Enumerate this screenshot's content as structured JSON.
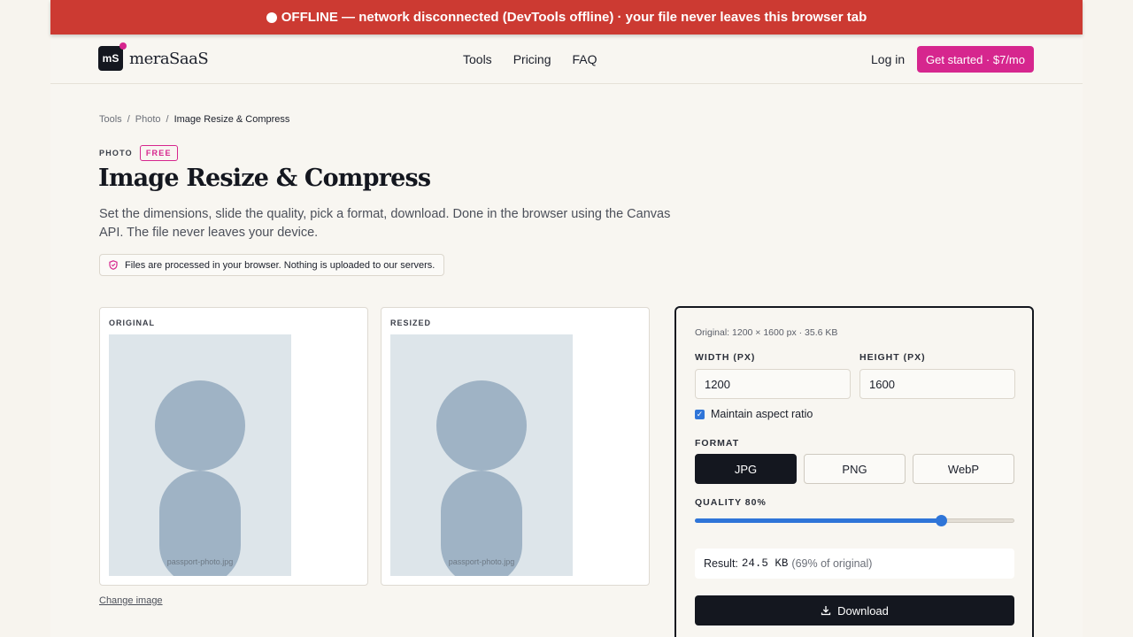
{
  "offline_banner": {
    "icon": "dot-icon",
    "text": "OFFLINE — network disconnected (DevTools offline) · your file never leaves this browser tab",
    "color": "#cc3a32"
  },
  "brand": {
    "mark": "mS",
    "name": "meraSaaS",
    "accent": "#d6268e"
  },
  "nav": {
    "links": [
      "Tools",
      "Pricing",
      "FAQ"
    ],
    "login": "Log in",
    "cta": "Get started · $7/mo"
  },
  "breadcrumb": {
    "items": [
      "Tools",
      "Photo"
    ],
    "current": "Image Resize & Compress",
    "separator": "/"
  },
  "hero": {
    "eyebrow": "PHOTO",
    "badge": "FREE",
    "title": "Image Resize & Compress",
    "subtitle": "Set the dimensions, slide the quality, pick a format, download. Done in the browser using the Canvas API. The file never leaves your device.",
    "privacy": "Files are processed in your browser. Nothing is uploaded to our servers."
  },
  "previews": {
    "original": {
      "label": "ORIGINAL",
      "caption": "passport-photo.jpg"
    },
    "resized": {
      "label": "RESIZED",
      "caption": "passport-photo.jpg"
    },
    "change_link": "Change image"
  },
  "settings": {
    "original_info": "Original: 1200 × 1600 px · 35.6 KB",
    "width_label": "WIDTH (PX)",
    "width_value": "1200",
    "height_label": "HEIGHT (PX)",
    "height_value": "1600",
    "aspect_label": "Maintain aspect ratio",
    "aspect_checked": true,
    "format_label": "FORMAT",
    "formats": [
      "JPG",
      "PNG",
      "WebP"
    ],
    "selected_format": "JPG",
    "quality_label": "QUALITY 80%",
    "quality_value": 0.77,
    "result_prefix": "Result:",
    "result_size": "24.5 KB",
    "result_pct": "(69% of original)",
    "download": "Download"
  }
}
